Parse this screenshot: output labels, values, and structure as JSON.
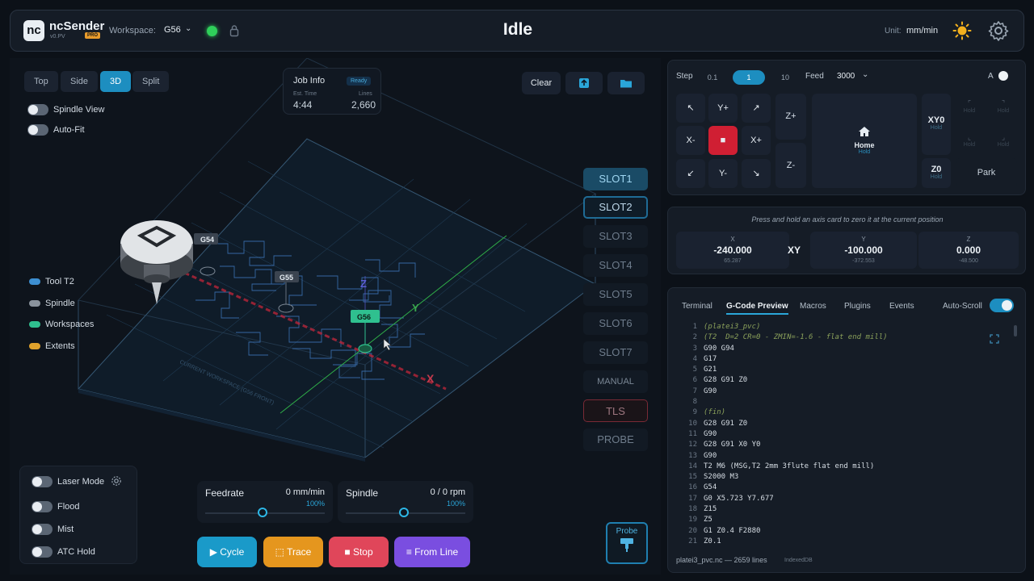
{
  "header": {
    "logo_text": "nc",
    "brand": "ncSender",
    "brand_sub": "v0.PV",
    "pro_badge": "PRO",
    "workspace_label": "Workspace:",
    "workspace_value": "G56",
    "status_title": "Idle",
    "unit_label": "Unit:",
    "unit_value": "mm/min",
    "colors": {
      "status_green": "#2fcf5a",
      "accent": "#1d8ec0",
      "sun": "#f2b01e"
    }
  },
  "viz": {
    "view_buttons": [
      "Top",
      "Side",
      "3D",
      "Split"
    ],
    "active_view": "3D",
    "toggles": [
      {
        "label": "Spindle View",
        "on": false
      },
      {
        "label": "Auto-Fit",
        "on": false
      }
    ],
    "legend": [
      {
        "label": "Tool T2",
        "color": "#3d8fd1"
      },
      {
        "label": "Spindle",
        "color": "#8a939d"
      },
      {
        "label": "Workspaces",
        "color": "#2fc08f"
      },
      {
        "label": "Extents",
        "color": "#e0a22c"
      }
    ],
    "job_info": {
      "title": "Job Info",
      "status": "Ready",
      "est_time_label": "Est. Time",
      "est_time": "4:44",
      "lines_label": "Lines",
      "lines": "2,660"
    },
    "top_buttons": {
      "clear": "Clear"
    },
    "workspace_markers": [
      "G54",
      "G55",
      "G56"
    ],
    "axis_labels": {
      "x": "X",
      "y": "Y",
      "z": "Z"
    },
    "plate_text": "CURRENT WORKSPACE (G56 FRONT)",
    "slots": [
      "SLOT1",
      "SLOT2",
      "SLOT3",
      "SLOT4",
      "SLOT5",
      "SLOT6",
      "SLOT7",
      "MANUAL",
      "TLS",
      "PROBE"
    ],
    "mode_toggles": [
      {
        "label": "Laser Mode",
        "on": false
      },
      {
        "label": "Flood",
        "on": false
      },
      {
        "label": "Mist",
        "on": false
      },
      {
        "label": "ATC Hold",
        "on": false
      }
    ],
    "feedrate": {
      "title": "Feedrate",
      "value": "0 mm/min",
      "pct": "100%",
      "level": 0.5
    },
    "spindle": {
      "title": "Spindle",
      "value": "0 / 0 rpm",
      "pct": "100%",
      "level": 0.5
    },
    "actions": [
      {
        "label": "Cycle",
        "icon": "play-icon",
        "color": "#1a9ac9"
      },
      {
        "label": "Trace",
        "icon": "trace-icon",
        "color": "#e5961e"
      },
      {
        "label": "Stop",
        "icon": "stop-icon",
        "color": "#e0465a"
      },
      {
        "label": "From Line",
        "icon": "lines-icon",
        "color": "#7a4ee0"
      }
    ],
    "probe_label": "Probe"
  },
  "jog": {
    "step_label": "Step",
    "steps": [
      "0.1",
      "1",
      "10"
    ],
    "active_step": "1",
    "feed_label": "Feed",
    "feed_value": "3000",
    "a_label": "A",
    "y_plus": "Y+",
    "y_minus": "Y-",
    "x_plus": "X+",
    "x_minus": "X-",
    "z_plus": "Z+",
    "z_minus": "Z-",
    "home": "Home",
    "hold": "Hold",
    "xy0": "XY0",
    "z0": "Z0",
    "park": "Park"
  },
  "axes": {
    "hint": "Press and hold an axis card to zero it at the current position",
    "x": {
      "label": "X",
      "value": "-240.000",
      "sub": "65.287"
    },
    "xy": "XY",
    "y": {
      "label": "Y",
      "value": "-100.000",
      "sub": "-372.553"
    },
    "z": {
      "label": "Z",
      "value": "0.000",
      "sub": "-48.500"
    }
  },
  "console": {
    "tabs": [
      "Terminal",
      "G-Code Preview",
      "Macros",
      "Plugins",
      "Events"
    ],
    "active_tab": "G-Code Preview",
    "autoscroll_label": "Auto-Scroll",
    "autoscroll_on": true,
    "lines": [
      {
        "n": "1",
        "t": "(platei3_pvc)",
        "k": "comment"
      },
      {
        "n": "2",
        "t": "(T2  D=2 CR=0 - ZMIN=-1.6 - flat end mill)",
        "k": "comment"
      },
      {
        "n": "3",
        "t": "G90 G94",
        "k": "g"
      },
      {
        "n": "4",
        "t": "G17",
        "k": "g"
      },
      {
        "n": "5",
        "t": "G21",
        "k": "g"
      },
      {
        "n": "6",
        "t": "G28 G91 Z0",
        "k": "g"
      },
      {
        "n": "7",
        "t": "G90",
        "k": "g"
      },
      {
        "n": "8",
        "t": "",
        "k": "g"
      },
      {
        "n": "9",
        "t": "(fin)",
        "k": "comment"
      },
      {
        "n": "10",
        "t": "G28 G91 Z0",
        "k": "g"
      },
      {
        "n": "11",
        "t": "G90",
        "k": "g"
      },
      {
        "n": "12",
        "t": "G28 G91 X0 Y0",
        "k": "g"
      },
      {
        "n": "13",
        "t": "G90",
        "k": "g"
      },
      {
        "n": "14",
        "t": "T2 M6 (MSG,T2 2mm 3flute flat end mill)",
        "k": "g"
      },
      {
        "n": "15",
        "t": "S2000 M3",
        "k": "g"
      },
      {
        "n": "16",
        "t": "G54",
        "k": "g"
      },
      {
        "n": "17",
        "t": "G0 X5.723 Y7.677",
        "k": "g"
      },
      {
        "n": "18",
        "t": "Z15",
        "k": "g"
      },
      {
        "n": "19",
        "t": "Z5",
        "k": "g"
      },
      {
        "n": "20",
        "t": "G1 Z0.4 F2880",
        "k": "g"
      },
      {
        "n": "21",
        "t": "Z0.1",
        "k": "g"
      }
    ],
    "file": "platei3_pvc.nc — 2659 lines",
    "storage": "IndexedDB"
  }
}
